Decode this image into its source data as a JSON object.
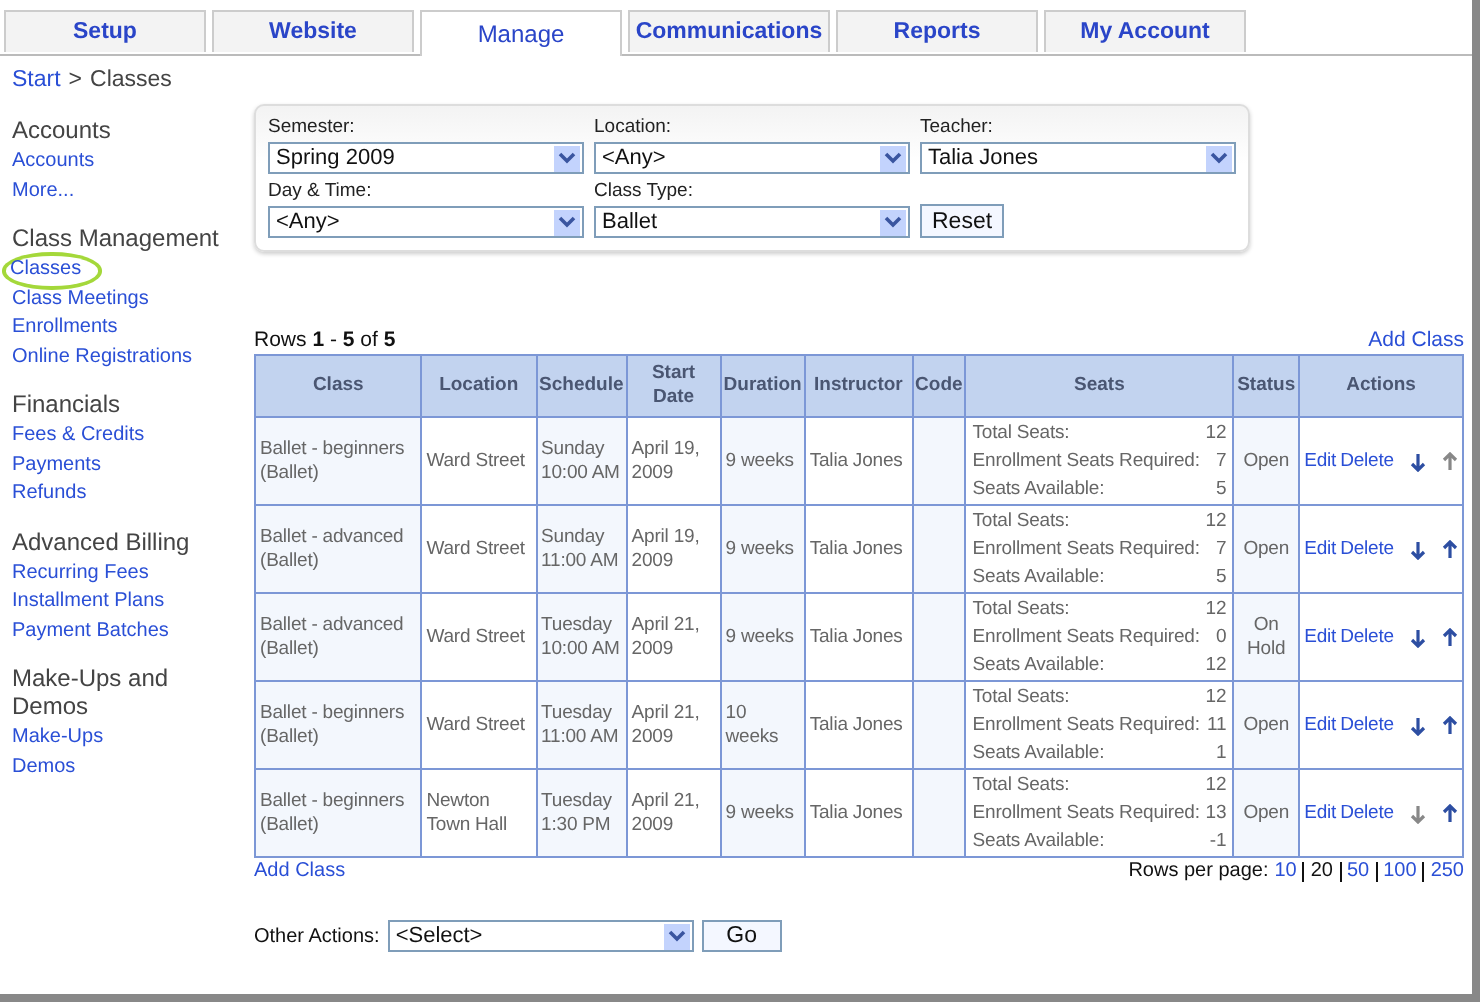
{
  "tabs": [
    {
      "label": "Setup",
      "selected": false
    },
    {
      "label": "Website",
      "selected": false
    },
    {
      "label": "Manage",
      "selected": true
    },
    {
      "label": "Communications",
      "selected": false
    },
    {
      "label": "Reports",
      "selected": false
    },
    {
      "label": "My Account",
      "selected": false
    }
  ],
  "breadcrumb": {
    "link": "Start",
    "separator": ">",
    "current": "Classes"
  },
  "sidebar": [
    {
      "heading": "Accounts",
      "items": [
        {
          "label": "Accounts",
          "selected": false
        },
        {
          "label": "More...",
          "selected": false
        }
      ]
    },
    {
      "heading": "Class Management",
      "items": [
        {
          "label": "Classes",
          "selected": true
        },
        {
          "label": "Class Meetings",
          "selected": false
        },
        {
          "label": "Enrollments",
          "selected": false
        },
        {
          "label": "Online Registrations",
          "selected": false
        }
      ]
    },
    {
      "heading": "Financials",
      "items": [
        {
          "label": "Fees & Credits",
          "selected": false
        },
        {
          "label": "Payments",
          "selected": false
        },
        {
          "label": "Refunds",
          "selected": false
        }
      ]
    },
    {
      "heading": "Advanced Billing",
      "items": [
        {
          "label": "Recurring Fees",
          "selected": false
        },
        {
          "label": "Installment Plans",
          "selected": false
        },
        {
          "label": "Payment Batches",
          "selected": false
        }
      ]
    },
    {
      "heading": "Make-Ups and Demos",
      "items": [
        {
          "label": "Make-Ups",
          "selected": false
        },
        {
          "label": "Demos",
          "selected": false
        }
      ]
    }
  ],
  "filters": [
    {
      "label": "Semester:",
      "value": "Spring 2009"
    },
    {
      "label": "Location:",
      "value": "<Any>"
    },
    {
      "label": "Teacher:",
      "value": "Talia Jones"
    },
    {
      "label": "Day & Time:",
      "value": "<Any>"
    },
    {
      "label": "Class Type:",
      "value": "Ballet"
    }
  ],
  "reset_button": "Reset",
  "rows_summary": "Rows **1** - **5** of **5**",
  "add_class_top": "Add Class",
  "table": {
    "columns": [
      "Class",
      "Location",
      "Schedule",
      "Start Date",
      "Duration",
      "Instructor",
      "Code",
      "Seats",
      "Status",
      "Actions"
    ],
    "rows": [
      {
        "class": "Ballet - beginners (Ballet)",
        "location": "Ward Street",
        "schedule": "Sunday 10:00 AM",
        "start_date": "April 19, 2009",
        "duration": "9 weeks",
        "instructor": "Talia Jones",
        "seats": [
          {
            "label": "Total Seats:",
            "value": "12"
          },
          {
            "label": "Enrollment Seats Required:",
            "value": "7"
          },
          {
            "label": "Seats Available:",
            "value": "5"
          }
        ],
        "status": "Open",
        "edit": "Edit",
        "delete": "Delete",
        "down_disabled": false,
        "up_disabled": true
      },
      {
        "class": "Ballet - advanced (Ballet)",
        "location": "Ward Street",
        "schedule": "Sunday 11:00 AM",
        "start_date": "April 19, 2009",
        "duration": "9 weeks",
        "instructor": "Talia Jones",
        "seats": [
          {
            "label": "Total Seats:",
            "value": "12"
          },
          {
            "label": "Enrollment Seats Required:",
            "value": "7"
          },
          {
            "label": "Seats Available:",
            "value": "5"
          }
        ],
        "status": "Open",
        "edit": "Edit",
        "delete": "Delete",
        "down_disabled": false,
        "up_disabled": false
      },
      {
        "class": "Ballet - advanced (Ballet)",
        "location": "Ward Street",
        "schedule": "Tuesday 10:00 AM",
        "start_date": "April 21, 2009",
        "duration": "9 weeks",
        "instructor": "Talia Jones",
        "seats": [
          {
            "label": "Total Seats:",
            "value": "12"
          },
          {
            "label": "Enrollment Seats Required:",
            "value": "0"
          },
          {
            "label": "Seats Available:",
            "value": "12"
          }
        ],
        "status": "On Hold",
        "edit": "Edit",
        "delete": "Delete",
        "down_disabled": false,
        "up_disabled": false
      },
      {
        "class": "Ballet - beginners (Ballet)",
        "location": "Ward Street",
        "schedule": "Tuesday 11:00 AM",
        "start_date": "April 21, 2009",
        "duration": "10 weeks",
        "instructor": "Talia Jones",
        "seats": [
          {
            "label": "Total Seats:",
            "value": "12"
          },
          {
            "label": "Enrollment Seats Required:",
            "value": "11"
          },
          {
            "label": "Seats Available:",
            "value": "1"
          }
        ],
        "status": "Open",
        "edit": "Edit",
        "delete": "Delete",
        "down_disabled": false,
        "up_disabled": false
      },
      {
        "class": "Ballet - beginners (Ballet)",
        "location": "Newton Town Hall",
        "schedule": "Tuesday 1:30 PM",
        "start_date": "April 21, 2009",
        "duration": "9 weeks",
        "instructor": "Talia Jones",
        "seats": [
          {
            "label": "Total Seats:",
            "value": "12"
          },
          {
            "label": "Enrollment Seats Required:",
            "value": "13"
          },
          {
            "label": "Seats Available:",
            "value": "-1"
          }
        ],
        "status": "Open",
        "edit": "Edit",
        "delete": "Delete",
        "down_disabled": true,
        "up_disabled": false
      }
    ]
  },
  "add_class_bottom": "Add Class",
  "rows_per_page": {
    "label": "Rows per page:",
    "options": [
      {
        "label": "10",
        "selected": false
      },
      {
        "label": "20",
        "selected": true
      },
      {
        "label": "50",
        "selected": false
      },
      {
        "label": "100",
        "selected": false
      },
      {
        "label": "250",
        "selected": false
      }
    ]
  },
  "other_actions": {
    "label": "Other Actions:",
    "value": "<Select>",
    "button": "Go"
  }
}
